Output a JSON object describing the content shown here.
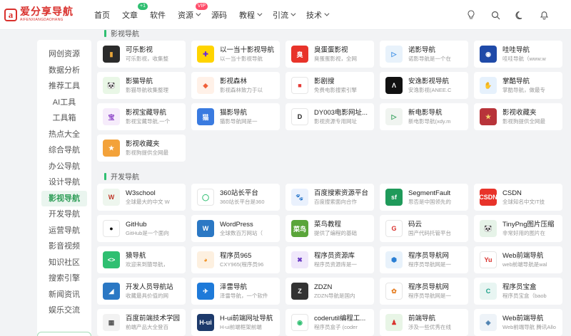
{
  "logo": {
    "mark": "a",
    "title": "爱分享导航",
    "subtitle": "AIFENXIANGDAOHANG"
  },
  "nav": [
    {
      "label": "首页",
      "chevron": false
    },
    {
      "label": "文章",
      "chevron": false,
      "badge": "+1"
    },
    {
      "label": "软件",
      "chevron": false
    },
    {
      "label": "资源",
      "chevron": true,
      "badge": "VIP"
    },
    {
      "label": "源码",
      "chevron": false
    },
    {
      "label": "教程",
      "chevron": true
    },
    {
      "label": "引流",
      "chevron": true
    },
    {
      "label": "技术",
      "chevron": true
    }
  ],
  "header_icons": [
    "bulb-icon",
    "search-icon",
    "moon-icon",
    "bell-icon"
  ],
  "sidebar": {
    "items": [
      "网创资源",
      "数据分析",
      "推荐工具",
      "AI工具",
      "工具箱",
      "热点大全",
      "综合导航",
      "办公导航",
      "设计导航",
      "影视导航",
      "开发导航",
      "运营导航",
      "影音视频",
      "知识社区",
      "搜索引擎",
      "新闻资讯",
      "娱乐交流"
    ],
    "active": "影视导航"
  },
  "sections": [
    {
      "title": "影视导航",
      "cards": [
        {
          "name": "可乐影视",
          "desc": "可乐影视，收集整",
          "icon": {
            "bg": "#2b2b2b",
            "fg": "#e8a53a",
            "glyph": "▮"
          }
        },
        {
          "name": "以一当十影视导航",
          "desc": "以一当十影视导航",
          "icon": {
            "bg": "#ffd400",
            "fg": "#6a2bd9",
            "glyph": "✚"
          }
        },
        {
          "name": "臭蛋蛋影视",
          "desc": "臭蛋蛋影视，全网",
          "icon": {
            "bg": "#e8332a",
            "fg": "#fff",
            "glyph": "臭"
          }
        },
        {
          "name": "诺影导航",
          "desc": "诺影导航是一个在",
          "icon": {
            "bg": "#e8f2fb",
            "fg": "#3a8ee6",
            "glyph": "▷"
          }
        },
        {
          "name": "哇哇导航",
          "desc": "哇哇导航（www.w",
          "icon": {
            "bg": "#1f4aa8",
            "fg": "#fff",
            "glyph": "◉"
          }
        },
        {
          "name": "影猫导航",
          "desc": "影猫导航收集整理",
          "icon": {
            "bg": "#e9f7e6",
            "fg": "#222",
            "glyph": "🐼"
          }
        },
        {
          "name": "影视森林",
          "desc": "影视森林致力于以",
          "icon": {
            "bg": "#fff1e8",
            "fg": "#f0603a",
            "glyph": "◆"
          }
        },
        {
          "name": "影剧搜",
          "desc": "免费电影搜索引擎",
          "icon": {
            "bg": "#fff",
            "fg": "#e53935",
            "glyph": "■"
          }
        },
        {
          "name": "安逸影视导航",
          "desc": "安逸影视(ANEE.C",
          "icon": {
            "bg": "#111",
            "fg": "#fff",
            "glyph": "Λ"
          }
        },
        {
          "name": "掌酷导航",
          "desc": "掌酷导航，做最专",
          "icon": {
            "bg": "#e6f1fc",
            "fg": "#1e7ad9",
            "glyph": "✋"
          }
        },
        {
          "name": "影视宝藏导航",
          "desc": "影视宝藏导航,一个",
          "icon": {
            "bg": "#f6ecfb",
            "fg": "#8a3fc7",
            "glyph": "宝"
          }
        },
        {
          "name": "猫影导航",
          "desc": "猫影导航网是一",
          "icon": {
            "bg": "#3a7be0",
            "fg": "#fff",
            "glyph": "猫"
          }
        },
        {
          "name": "DY003电影网址...",
          "desc": "影视资源专用网址",
          "icon": {
            "bg": "#fff",
            "fg": "#222",
            "glyph": "D"
          }
        },
        {
          "name": "新电影导航",
          "desc": "新电影导航(xdy.m",
          "icon": {
            "bg": "#f0f4f0",
            "fg": "#2f9e58",
            "glyph": "▷"
          }
        },
        {
          "name": "影视收藏夹",
          "desc": "影视狗提供全网最",
          "icon": {
            "bg": "#b8343a",
            "fg": "#f2d26b",
            "glyph": "★"
          }
        },
        {
          "name": "影视收藏夹",
          "desc": "影视狗提供全网最",
          "icon": {
            "bg": "#f3a23a",
            "fg": "#fff",
            "glyph": "★"
          }
        }
      ]
    },
    {
      "title": "开发导航",
      "cards": [
        {
          "name": "W3school",
          "desc": "全球最大的中文 W",
          "icon": {
            "bg": "#eef6ee",
            "fg": "#c0392b",
            "glyph": "W"
          }
        },
        {
          "name": "360站长平台",
          "desc": "360站长平台是360",
          "icon": {
            "bg": "#fff",
            "fg": "#2fbf71",
            "glyph": "◯"
          }
        },
        {
          "name": "百度搜索资源平台",
          "desc": "百度搜索面向合作",
          "icon": {
            "bg": "#eaf1fd",
            "fg": "#2d63d8",
            "glyph": "🐾"
          }
        },
        {
          "name": "SegmentFault",
          "desc": "思否是中国领先的",
          "icon": {
            "bg": "#1f9a5a",
            "fg": "#fff",
            "glyph": "sf"
          }
        },
        {
          "name": "CSDN",
          "desc": "全球知名中文IT技",
          "icon": {
            "bg": "#e8332a",
            "fg": "#fff",
            "glyph": "CSDN"
          }
        },
        {
          "name": "GitHub",
          "desc": "GitHub是一个面向",
          "icon": {
            "bg": "#fff",
            "fg": "#111",
            "glyph": "●"
          }
        },
        {
          "name": "WordPress",
          "desc": "全球数百万网站（",
          "icon": {
            "bg": "#2b78c4",
            "fg": "#fff",
            "glyph": "W"
          }
        },
        {
          "name": "菜鸟教程",
          "desc": "提供了编程的基础",
          "icon": {
            "bg": "#5aa53a",
            "fg": "#fff",
            "glyph": "菜鸟"
          }
        },
        {
          "name": "码云",
          "desc": "国产代码托管平台",
          "icon": {
            "bg": "#fff",
            "fg": "#d9302c",
            "glyph": "G"
          }
        },
        {
          "name": "TinyPng图片压缩",
          "desc": "非常好用的图片在",
          "icon": {
            "bg": "#e6f3e8",
            "fg": "#222",
            "glyph": "🐼"
          }
        },
        {
          "name": "猿导航",
          "desc": "欢迎来到猿导航，",
          "icon": {
            "bg": "#2fbf71",
            "fg": "#fff",
            "glyph": "<>"
          }
        },
        {
          "name": "程序员965",
          "desc": "CXY965(程序员96",
          "icon": {
            "bg": "#fdf0e0",
            "fg": "#f08c1a",
            "glyph": "◕"
          }
        },
        {
          "name": "程序员资源库",
          "desc": "程序员资源库是一",
          "icon": {
            "bg": "#f0e8fb",
            "fg": "#6a3bc4",
            "glyph": "✖"
          }
        },
        {
          "name": "程序员导航网",
          "desc": "程序员导航网是一",
          "icon": {
            "bg": "#e8f2fb",
            "fg": "#2a7fd4",
            "glyph": "⬢"
          }
        },
        {
          "name": "Web前端导航",
          "desc": "web前端导航是wal",
          "icon": {
            "bg": "#fff",
            "fg": "#d9302c",
            "glyph": "Yu"
          }
        },
        {
          "name": "开发人员导航站",
          "desc": "收藏最具价值的网",
          "icon": {
            "bg": "#2b78c4",
            "fg": "#fff",
            "glyph": "◢"
          }
        },
        {
          "name": "泽雷导航",
          "desc": "泽雷导航，一个软件",
          "icon": {
            "bg": "#1e7ad9",
            "fg": "#fff",
            "glyph": "✈"
          }
        },
        {
          "name": "ZDZN",
          "desc": "ZDZN导航是国内",
          "icon": {
            "bg": "#333",
            "fg": "#fff",
            "glyph": "Z"
          }
        },
        {
          "name": "程序员导航网",
          "desc": "程序员导航网是一",
          "icon": {
            "bg": "#fff",
            "fg": "#e67e22",
            "glyph": "✿"
          }
        },
        {
          "name": "程序员宝盒",
          "desc": "程序员宝盒（baob",
          "icon": {
            "bg": "#e8f5f2",
            "fg": "#1aa089",
            "glyph": "C"
          }
        },
        {
          "name": "百度前端技术学园",
          "desc": "前端产品大全登百",
          "icon": {
            "bg": "#f2f2f2",
            "fg": "#555",
            "glyph": "▦"
          }
        },
        {
          "name": "H-ui前端网址导航",
          "desc": "H-ui前端框架前端",
          "icon": {
            "bg": "#1d3a6b",
            "fg": "#fff",
            "glyph": "H-ui"
          }
        },
        {
          "name": "coderutil编程工...",
          "desc": "程序员盒子 (coder",
          "icon": {
            "bg": "#fff",
            "fg": "#2fbf71",
            "glyph": "◉"
          }
        },
        {
          "name": "前端导航",
          "desc": "涉及一些优秀在线",
          "icon": {
            "bg": "#e8f5e6",
            "fg": "#d9302c",
            "glyph": "♟"
          }
        },
        {
          "name": "Web前端导航",
          "desc": "Web前端导航 腾讯Allo",
          "icon": {
            "bg": "#eef3f8",
            "fg": "#4a7fb0",
            "glyph": "◈"
          }
        }
      ]
    }
  ]
}
